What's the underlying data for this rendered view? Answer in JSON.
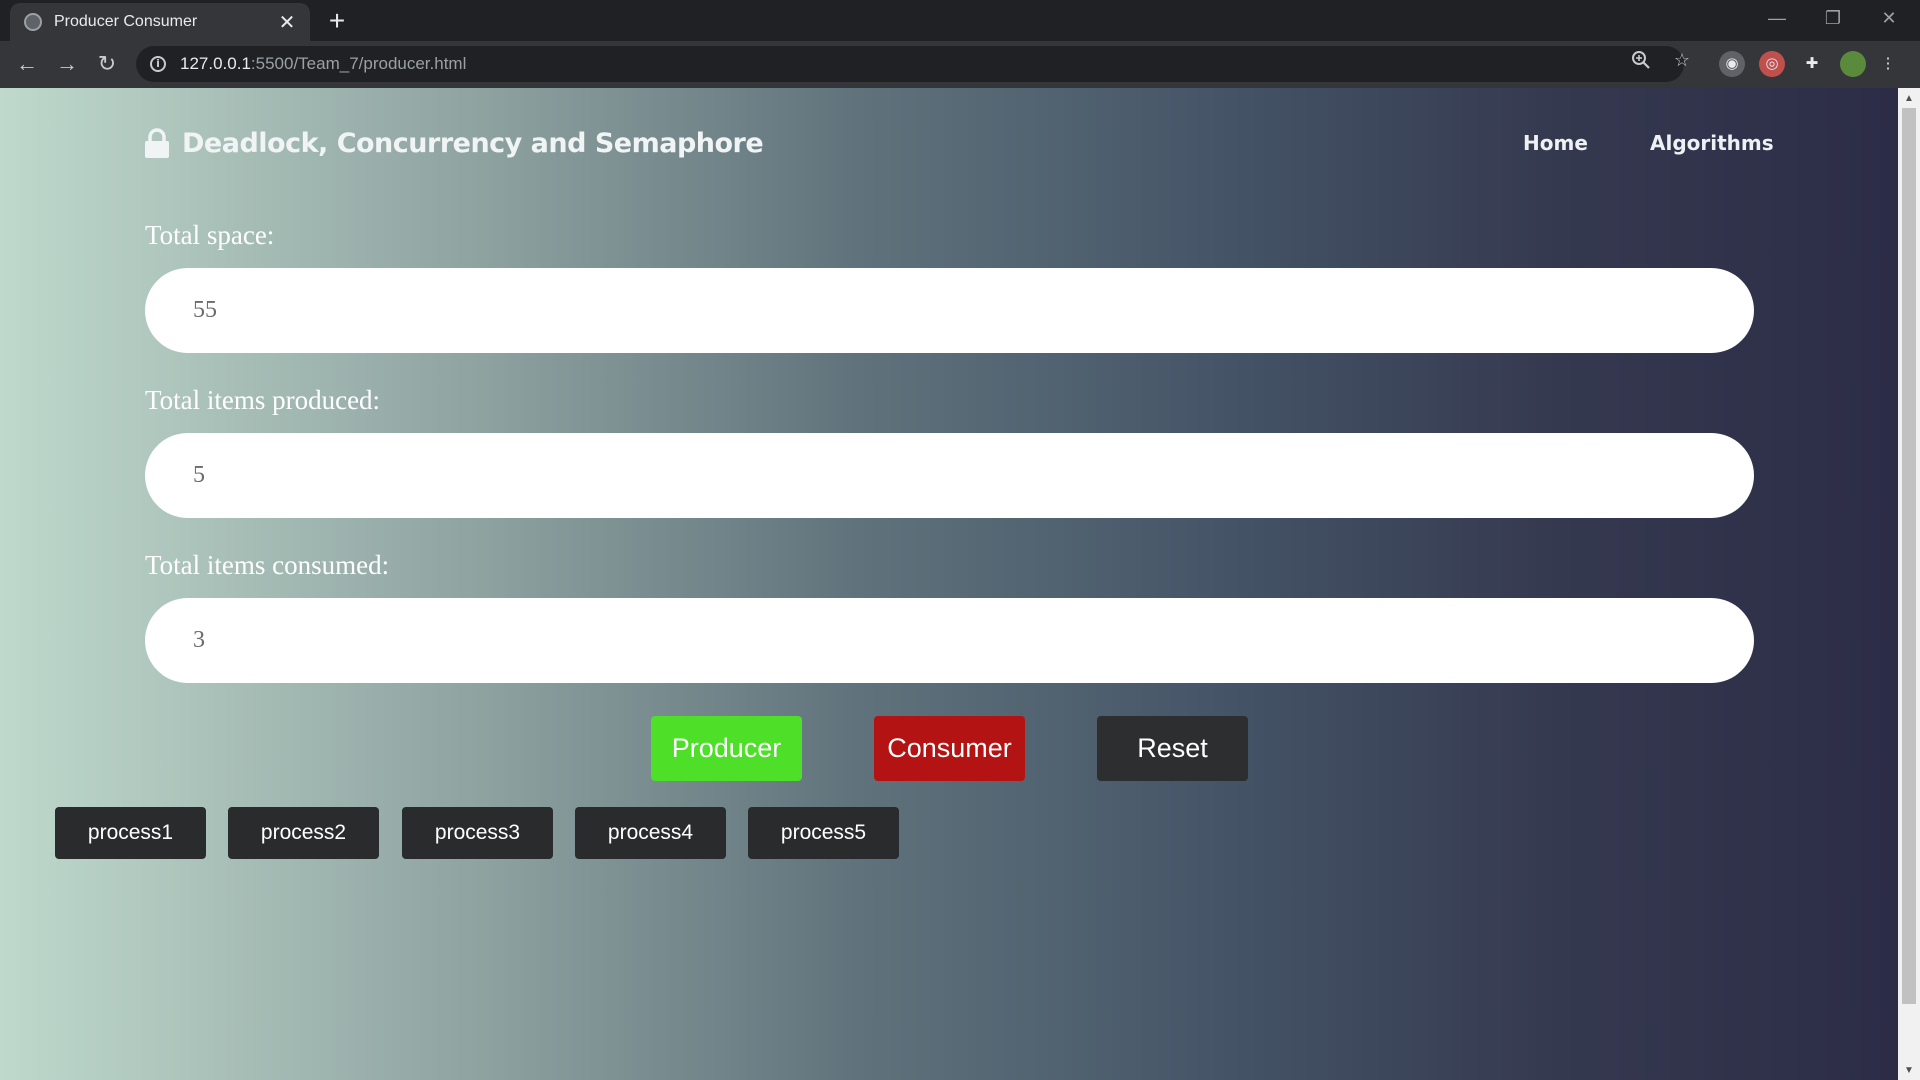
{
  "browser": {
    "tab_title": "Producer Consumer",
    "tab_close": "✕",
    "new_tab": "+",
    "url_host": "127.0.0.1",
    "url_rest": ":5500/Team_7/producer.html",
    "window_controls": [
      "—",
      "❐",
      "✕"
    ]
  },
  "header": {
    "brand_title": "Deadlock, Concurrency and Semaphore",
    "nav": [
      "Home",
      "Algorithms"
    ]
  },
  "form": {
    "total_space_label": "Total space:",
    "total_space_value": "55",
    "produced_label": "Total items produced:",
    "produced_value": "5",
    "consumed_label": "Total items consumed:",
    "consumed_value": "3"
  },
  "actions": {
    "producer": "Producer",
    "consumer": "Consumer",
    "reset": "Reset"
  },
  "processes": [
    "process1",
    "process2",
    "process3",
    "process4",
    "process5"
  ],
  "colors": {
    "producer": "#4ee029",
    "consumer": "#b41313",
    "reset": "#2d2e30",
    "process": "#2a2b2d"
  }
}
